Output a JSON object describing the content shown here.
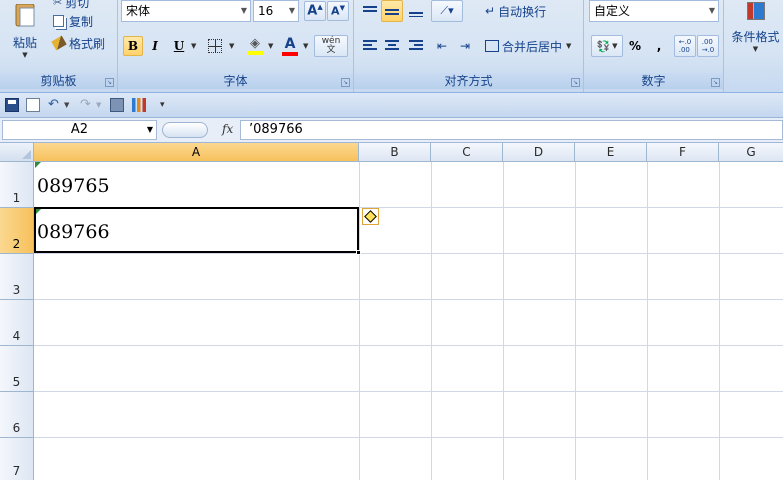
{
  "ribbon": {
    "clipboard": {
      "paste_label": "粘贴",
      "cut_label": "剪切",
      "copy_label": "复制",
      "format_painter_label": "格式刷",
      "group_label": "剪贴板"
    },
    "font": {
      "font_name": "宋体",
      "font_size": "16",
      "bold_label": "B",
      "italic_label": "I",
      "underline_label": "U",
      "font_color_label": "A",
      "group_label": "字体"
    },
    "alignment": {
      "wrap_text_label": "自动换行",
      "merge_center_label": "合并后居中",
      "group_label": "对齐方式"
    },
    "number": {
      "format_value": "自定义",
      "percent_label": "%",
      "comma_label": ",",
      "group_label": "数字"
    },
    "styles": {
      "conditional_format_label": "条件格式"
    }
  },
  "formula_bar": {
    "name_box": "A2",
    "fx_label": "fx",
    "content": "’089766"
  },
  "grid": {
    "columns": [
      "A",
      "B",
      "C",
      "D",
      "E",
      "F",
      "G"
    ],
    "rows": [
      "1",
      "2",
      "3",
      "4",
      "5",
      "6",
      "7"
    ],
    "cells": {
      "A1": "089765",
      "A2": "089766"
    }
  },
  "colors": {
    "selection_highlight": "#f7c15c",
    "ribbon_text": "#15428b"
  }
}
